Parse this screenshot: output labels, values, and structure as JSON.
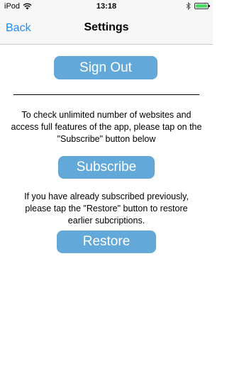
{
  "status": {
    "carrier": "iPod",
    "time": "13:18",
    "battery_level": 1.0
  },
  "nav": {
    "back_label": "Back",
    "title": "Settings"
  },
  "main": {
    "signout_label": "Sign Out",
    "subscribe_info": "To check unlimited number of websites and access full features of the app, please tap on the \"Subscribe\" button below",
    "subscribe_label": "Subscribe",
    "restore_info": "If you have already subscribed previously, please tap the \"Restore\" button to restore earlier subcriptions.",
    "restore_label": "Restore"
  },
  "colors": {
    "button_bg": "#62a9d9",
    "link": "#1a8cff",
    "battery": "#4cd964"
  }
}
